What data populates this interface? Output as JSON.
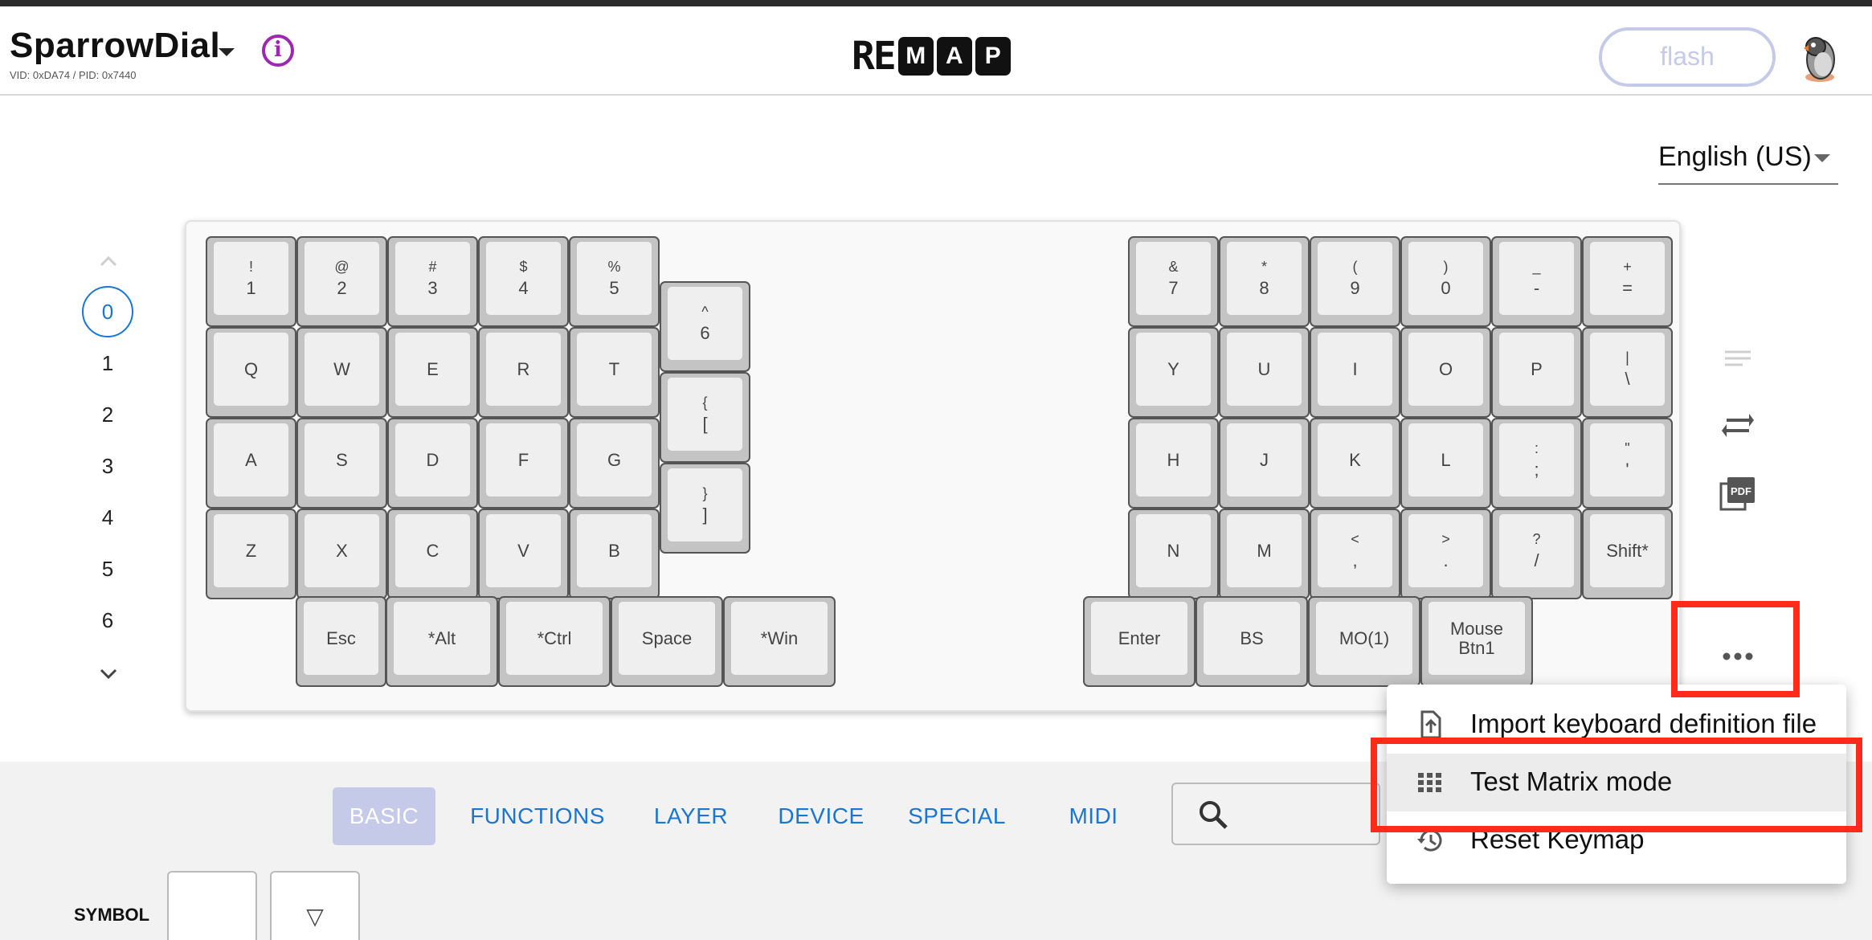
{
  "header": {
    "keyboard_name": "SparrowDial",
    "vid_pid": "VID: 0xDA74 / PID: 0x7440",
    "info_icon": "info-icon",
    "logo": [
      "RE",
      "M",
      "A",
      "P"
    ],
    "flash_label": "flash",
    "avatar_icon": "sparrow-avatar-icon"
  },
  "language": {
    "selected": "English (US)"
  },
  "layers": {
    "items": [
      "0",
      "1",
      "2",
      "3",
      "4",
      "5",
      "6"
    ],
    "active": "0"
  },
  "keyboard": {
    "left": [
      {
        "s": "!",
        "m": "1"
      },
      {
        "s": "@",
        "m": "2"
      },
      {
        "s": "#",
        "m": "3"
      },
      {
        "s": "$",
        "m": "4"
      },
      {
        "s": "%",
        "m": "5"
      },
      {
        "s": "^",
        "m": "6"
      },
      {
        "m": "Q"
      },
      {
        "m": "W"
      },
      {
        "m": "E"
      },
      {
        "m": "R"
      },
      {
        "m": "T"
      },
      {
        "s": "{",
        "m": "["
      },
      {
        "m": "A"
      },
      {
        "m": "S"
      },
      {
        "m": "D"
      },
      {
        "m": "F"
      },
      {
        "m": "G"
      },
      {
        "s": "}",
        "m": "]"
      },
      {
        "m": "Z"
      },
      {
        "m": "X"
      },
      {
        "m": "C"
      },
      {
        "m": "V"
      },
      {
        "m": "B"
      },
      {
        "m": "Esc"
      },
      {
        "m": "*Alt"
      },
      {
        "m": "*Ctrl"
      },
      {
        "m": "Space"
      },
      {
        "m": "*Win"
      }
    ],
    "right": [
      {
        "s": "&",
        "m": "7"
      },
      {
        "s": "*",
        "m": "8"
      },
      {
        "s": "(",
        "m": "9"
      },
      {
        "s": ")",
        "m": "0"
      },
      {
        "s": "_",
        "m": "-"
      },
      {
        "s": "+",
        "m": "="
      },
      {
        "m": "Y"
      },
      {
        "m": "U"
      },
      {
        "m": "I"
      },
      {
        "m": "O"
      },
      {
        "m": "P"
      },
      {
        "s": "|",
        "m": "\\"
      },
      {
        "m": "H"
      },
      {
        "m": "J"
      },
      {
        "m": "K"
      },
      {
        "m": "L"
      },
      {
        "s": ":",
        "m": ";"
      },
      {
        "s": "\"",
        "m": "'"
      },
      {
        "m": "N"
      },
      {
        "m": "M"
      },
      {
        "s": "<",
        "m": ","
      },
      {
        "s": ">",
        "m": "."
      },
      {
        "s": "?",
        "m": "/"
      },
      {
        "m": "Shift*"
      },
      {
        "m": "Enter"
      },
      {
        "m": "BS"
      },
      {
        "m": "MO(1)"
      },
      {
        "m": "Mouse Btn1"
      }
    ]
  },
  "side_tools": {
    "icons": [
      "notes-icon",
      "swap-icon",
      "pdf-icon",
      "more-horiz-icon"
    ],
    "pdf_text": "PDF"
  },
  "menu": {
    "items": [
      {
        "label": "Import keyboard definition file",
        "icon": "file-upload-icon"
      },
      {
        "label": "Test Matrix mode",
        "icon": "grid-icon"
      },
      {
        "label": "Reset Keymap",
        "icon": "history-icon"
      }
    ]
  },
  "bottom": {
    "tabs": [
      "BASIC",
      "FUNCTIONS",
      "LAYER",
      "DEVICE",
      "SPECIAL",
      "MIDI"
    ],
    "active_tab": "BASIC",
    "search_icon": "search-icon",
    "category_label": "SYMBOL",
    "symbol_keys": [
      "",
      "▽"
    ]
  },
  "annotations": {
    "highlight_color": "#ff2a1a"
  }
}
